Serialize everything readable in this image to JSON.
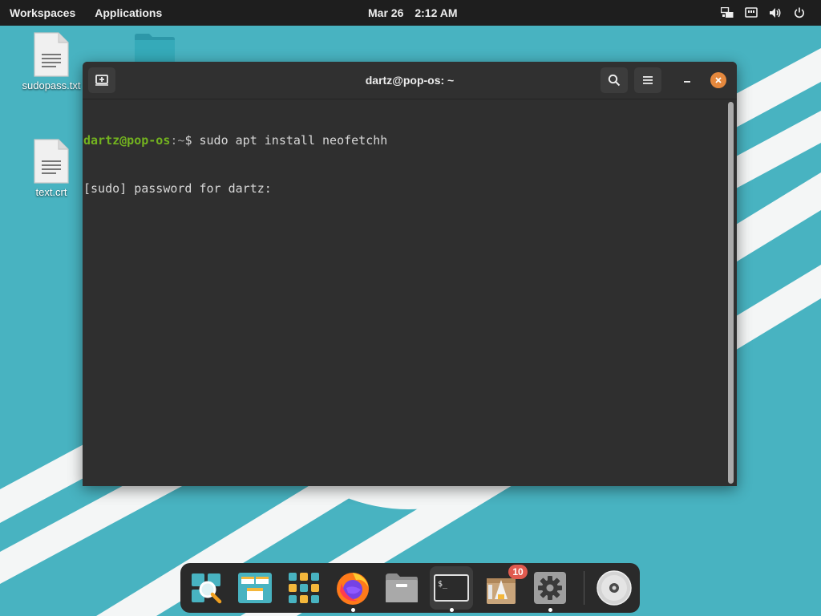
{
  "top_panel": {
    "workspaces_label": "Workspaces",
    "applications_label": "Applications",
    "date": "Mar 26",
    "time": "2:12 AM",
    "tray_icons": [
      "workspace-switcher-icon",
      "network-icon",
      "volume-icon",
      "power-icon"
    ]
  },
  "desktop": {
    "icons": [
      {
        "label": "sudopass.txt",
        "icon": "text-file-icon"
      },
      {
        "label": "text.crt",
        "icon": "text-file-icon"
      },
      {
        "label": "",
        "icon": "folder-icon"
      }
    ]
  },
  "terminal": {
    "title": "dartz@pop-os: ~",
    "prompt_user": "dartz@pop-os",
    "prompt_path": ":~",
    "prompt_symbol": "$",
    "command": " sudo apt install neofetchh",
    "output_line": "[sudo] password for dartz:",
    "header_buttons": [
      "new-tab-icon",
      "search-icon",
      "menu-icon",
      "minimize-icon",
      "close-icon"
    ]
  },
  "dock": {
    "items": [
      {
        "name": "launcher",
        "icon": "launcher-search-icon",
        "running": false
      },
      {
        "name": "workspaces",
        "icon": "workspaces-icon",
        "running": false
      },
      {
        "name": "applications",
        "icon": "app-grid-icon",
        "running": false
      },
      {
        "name": "firefox",
        "icon": "firefox-icon",
        "running": true
      },
      {
        "name": "files",
        "icon": "files-icon",
        "running": false
      },
      {
        "name": "terminal",
        "icon": "terminal-icon",
        "running": true,
        "active": true
      },
      {
        "name": "pop-shop",
        "icon": "pop-shop-icon",
        "running": false,
        "badge": "10"
      },
      {
        "name": "settings",
        "icon": "settings-gear-icon",
        "running": true
      },
      {
        "name": "disc",
        "icon": "optical-disc-icon",
        "running": false
      }
    ],
    "terminal_icon_text": "$_"
  },
  "colors": {
    "wallpaper": "#48b3c1",
    "panel": "#1e1e1e",
    "terminal_bg": "#2f2f2f",
    "prompt_green": "#73b31f",
    "close_orange": "#e5883d",
    "badge_red": "#e05a4f"
  }
}
